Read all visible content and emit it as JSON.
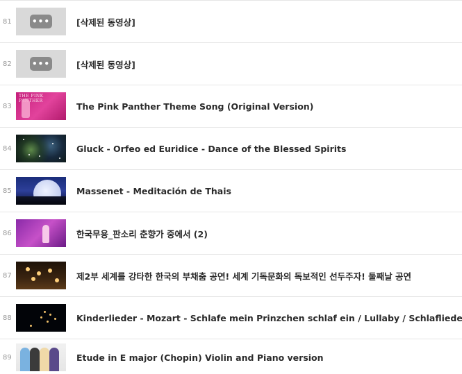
{
  "playlist": {
    "items": [
      {
        "index": "81",
        "title": "[삭제된 동영상]",
        "thumb": "deleted-video-placeholder",
        "thumb_icon": "•••"
      },
      {
        "index": "82",
        "title": "[삭제된 동영상]",
        "thumb": "deleted-video-placeholder",
        "thumb_icon": "•••"
      },
      {
        "index": "83",
        "title": "The Pink Panther Theme Song (Original Version)",
        "thumb": "pink-panther-thumbnail",
        "thumb_text": "THE PINK PANTHER"
      },
      {
        "index": "84",
        "title": "Gluck - Orfeo ed Euridice - Dance of the Blessed Spirits",
        "thumb": "nebula-thumbnail"
      },
      {
        "index": "85",
        "title": "Massenet - Meditación de Thais",
        "thumb": "moonlit-sea-thumbnail"
      },
      {
        "index": "86",
        "title": "한국무용_판소리 춘향가 중에서 (2)",
        "thumb": "korean-dance-stage-thumbnail"
      },
      {
        "index": "87",
        "title": "제2부 세계를 강타한 한국의 부채춤 공연! 세계 기독문화의 독보적인 선두주자! 둘째날 공연",
        "thumb": "fan-dance-stage-thumbnail"
      },
      {
        "index": "88",
        "title": "Kinderlieder - Mozart - Schlafe mein Prinzchen schlaf ein / Lullaby / Schlaflieder",
        "thumb": "night-lights-thumbnail"
      },
      {
        "index": "89",
        "title": "Etude in E major (Chopin) Violin and Piano version",
        "thumb": "anime-characters-thumbnail"
      }
    ]
  },
  "colors": {
    "divider": "#e5e5e5",
    "index_text": "#9a9a9a",
    "title_text": "#2b2b2b",
    "placeholder_bg": "#d9d9d9",
    "placeholder_icon_bg": "#8a8a8a"
  }
}
